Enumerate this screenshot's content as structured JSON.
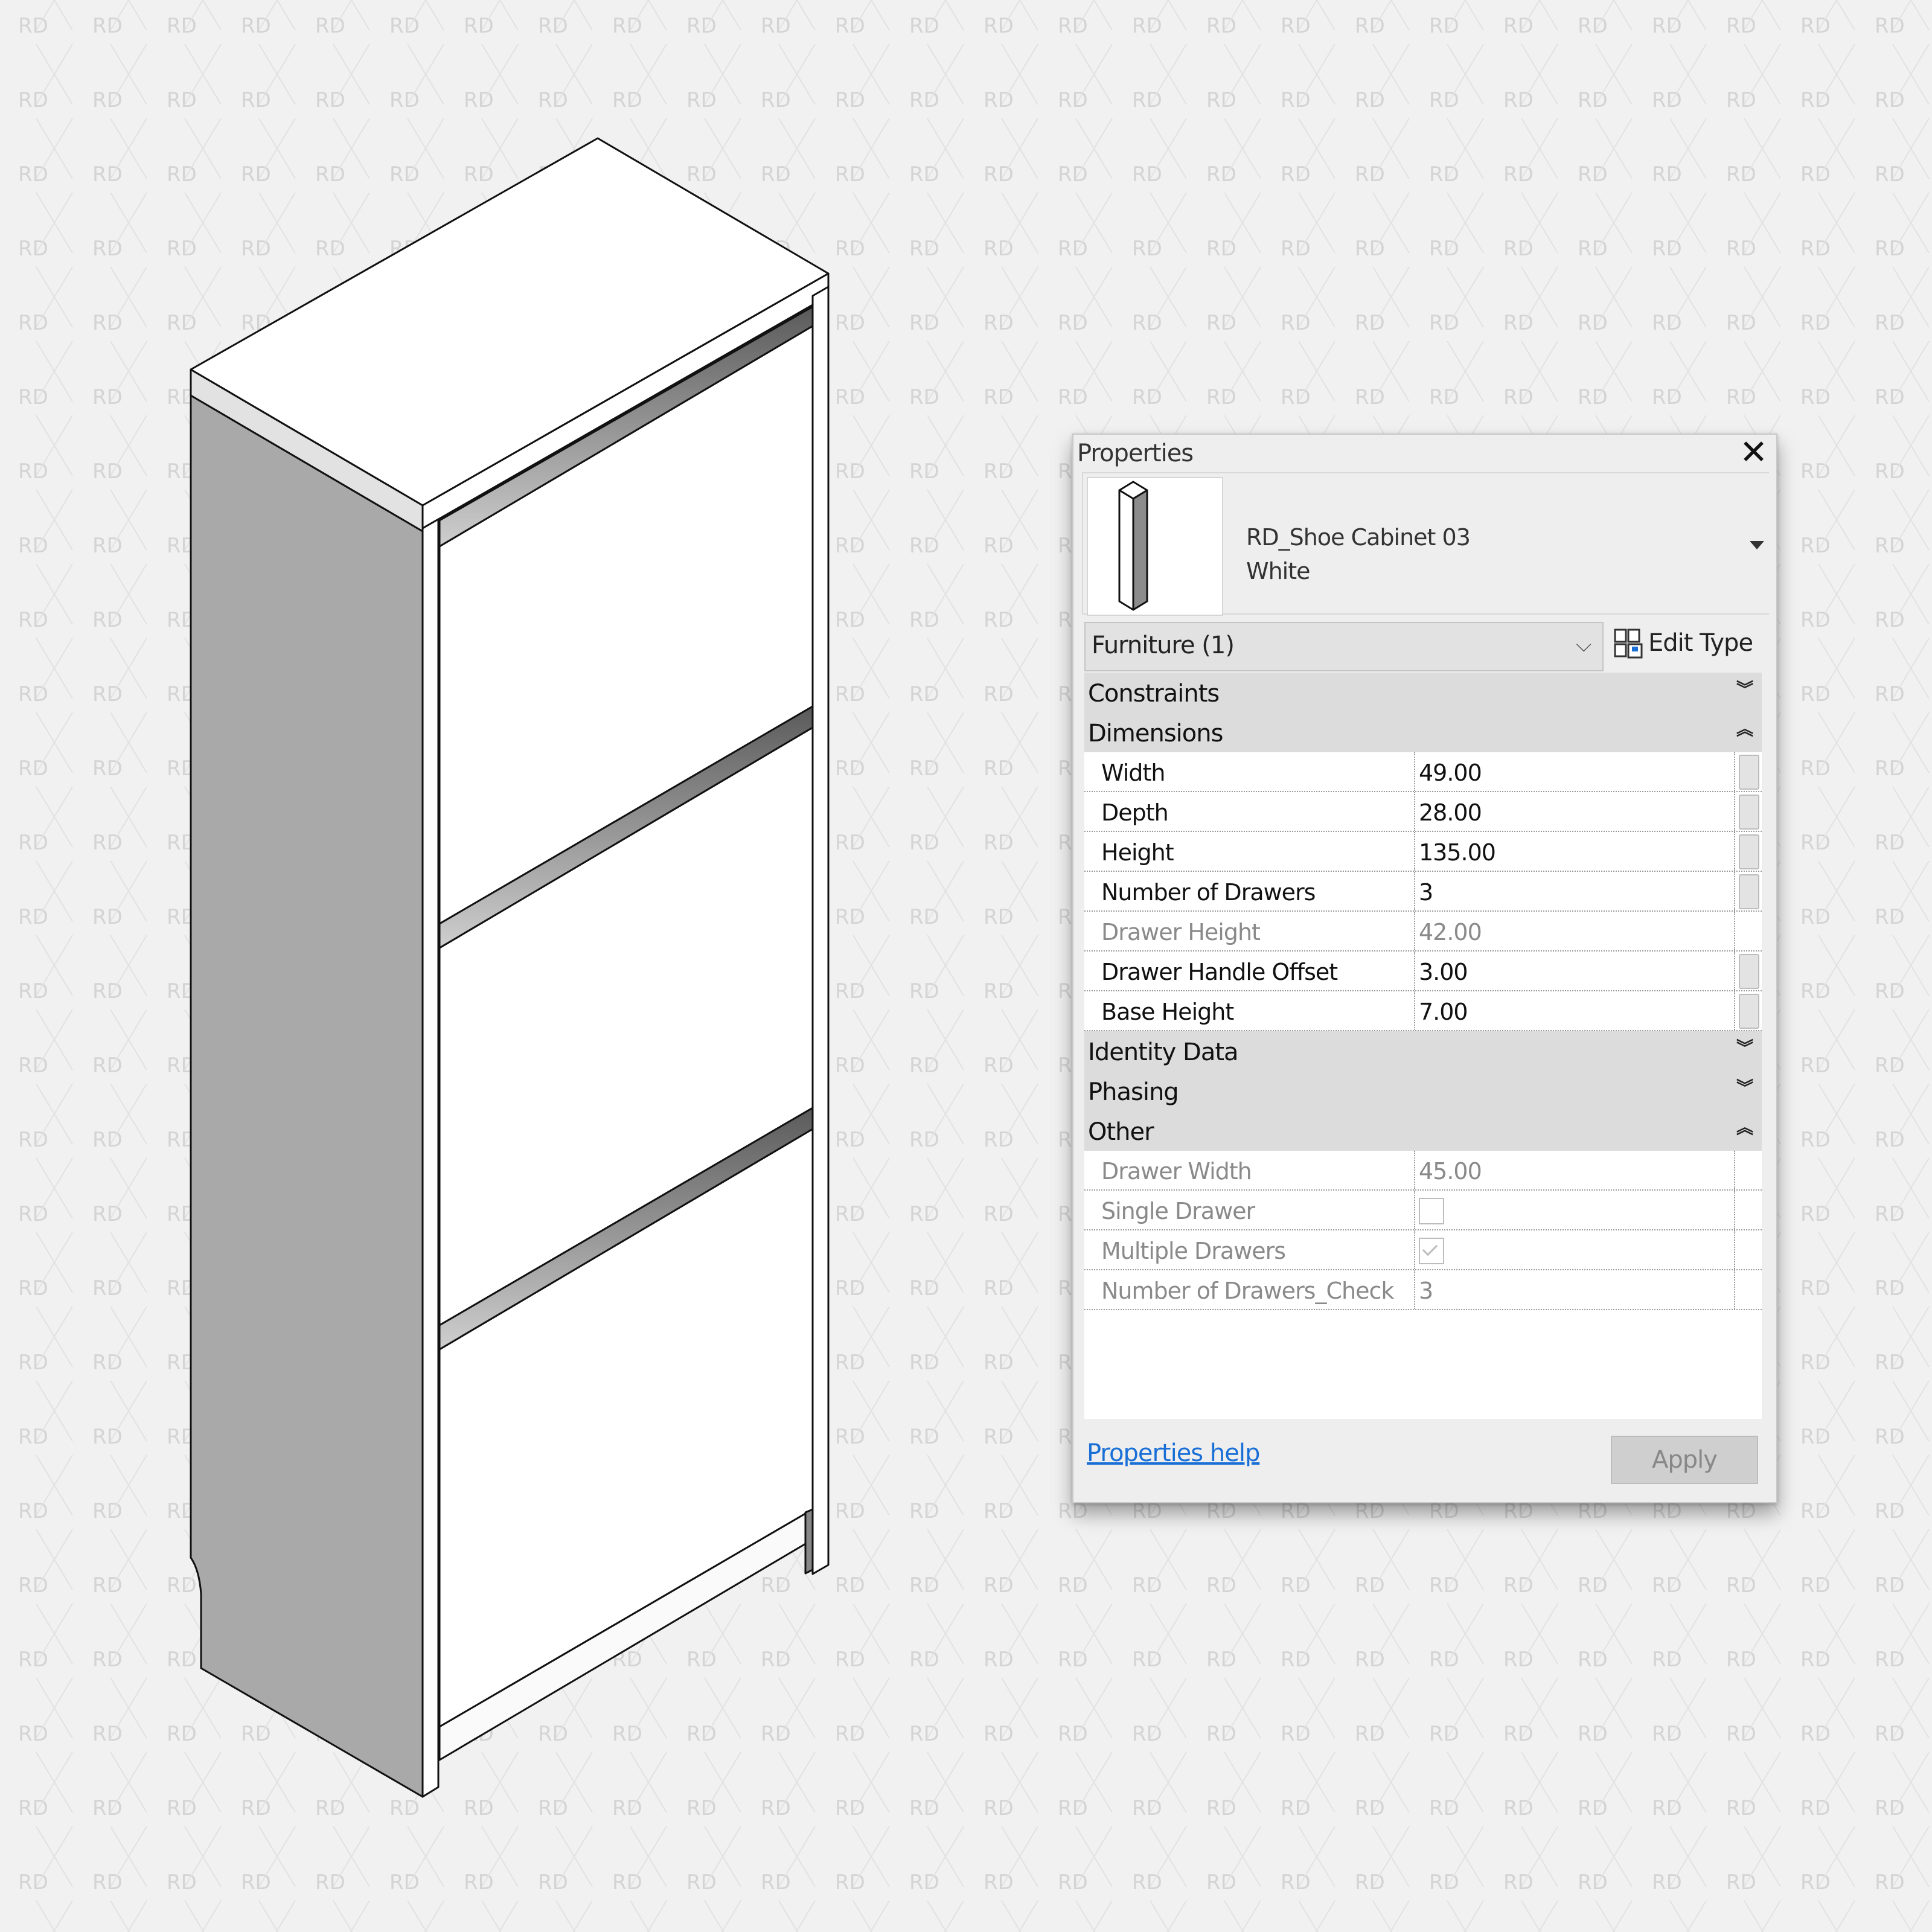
{
  "watermark": {
    "text": "RD",
    "color": "#d4d4d4"
  },
  "colors": {
    "background": "#f1f1f1",
    "cabinet_white": "#ffffff",
    "cabinet_side": "#a9a9a9",
    "outline": "#111111",
    "link": "#1a6fd6",
    "group_header": "#dcdcdc"
  },
  "drawing": {
    "object": "shoe-cabinet-isometric",
    "drawers": 3
  },
  "properties_panel": {
    "title": "Properties",
    "close_icon": "close-icon",
    "type_selector": {
      "family": "RD_Shoe Cabinet 03",
      "type": "White",
      "dropdown_icon": "triangle-down-icon"
    },
    "category_filter": {
      "value": "Furniture (1)",
      "chevron_icon": "chevron-down-icon"
    },
    "edit_type": {
      "label": "Edit Type",
      "icon": "edit-type-icon"
    },
    "groups": [
      {
        "name": "Constraints",
        "state": "collapsed",
        "rows": []
      },
      {
        "name": "Dimensions",
        "state": "expanded",
        "rows": [
          {
            "name": "Width",
            "value": "49.00",
            "readonly": false,
            "assoc_button": true
          },
          {
            "name": "Depth",
            "value": "28.00",
            "readonly": false,
            "assoc_button": true
          },
          {
            "name": "Height",
            "value": "135.00",
            "readonly": false,
            "assoc_button": true
          },
          {
            "name": "Number of Drawers",
            "value": "3",
            "readonly": false,
            "assoc_button": true
          },
          {
            "name": "Drawer Height",
            "value": "42.00",
            "readonly": true,
            "assoc_button": false
          },
          {
            "name": "Drawer Handle Offset",
            "value": "3.00",
            "readonly": false,
            "assoc_button": true
          },
          {
            "name": "Base Height",
            "value": "7.00",
            "readonly": false,
            "assoc_button": true
          }
        ]
      },
      {
        "name": "Identity Data",
        "state": "collapsed",
        "rows": []
      },
      {
        "name": "Phasing",
        "state": "collapsed",
        "rows": []
      },
      {
        "name": "Other",
        "state": "expanded",
        "rows": [
          {
            "name": "Drawer Width",
            "value": "45.00",
            "readonly": true
          },
          {
            "name": "Single Drawer",
            "checkbox": true,
            "checked": false,
            "readonly": true
          },
          {
            "name": "Multiple Drawers",
            "checkbox": true,
            "checked": true,
            "readonly": true
          },
          {
            "name": "Number of Drawers_Check",
            "value": "3",
            "readonly": true
          }
        ]
      }
    ],
    "collapse_glyph": "ˇˇ",
    "help_link": "Properties help",
    "apply_label": "Apply"
  }
}
